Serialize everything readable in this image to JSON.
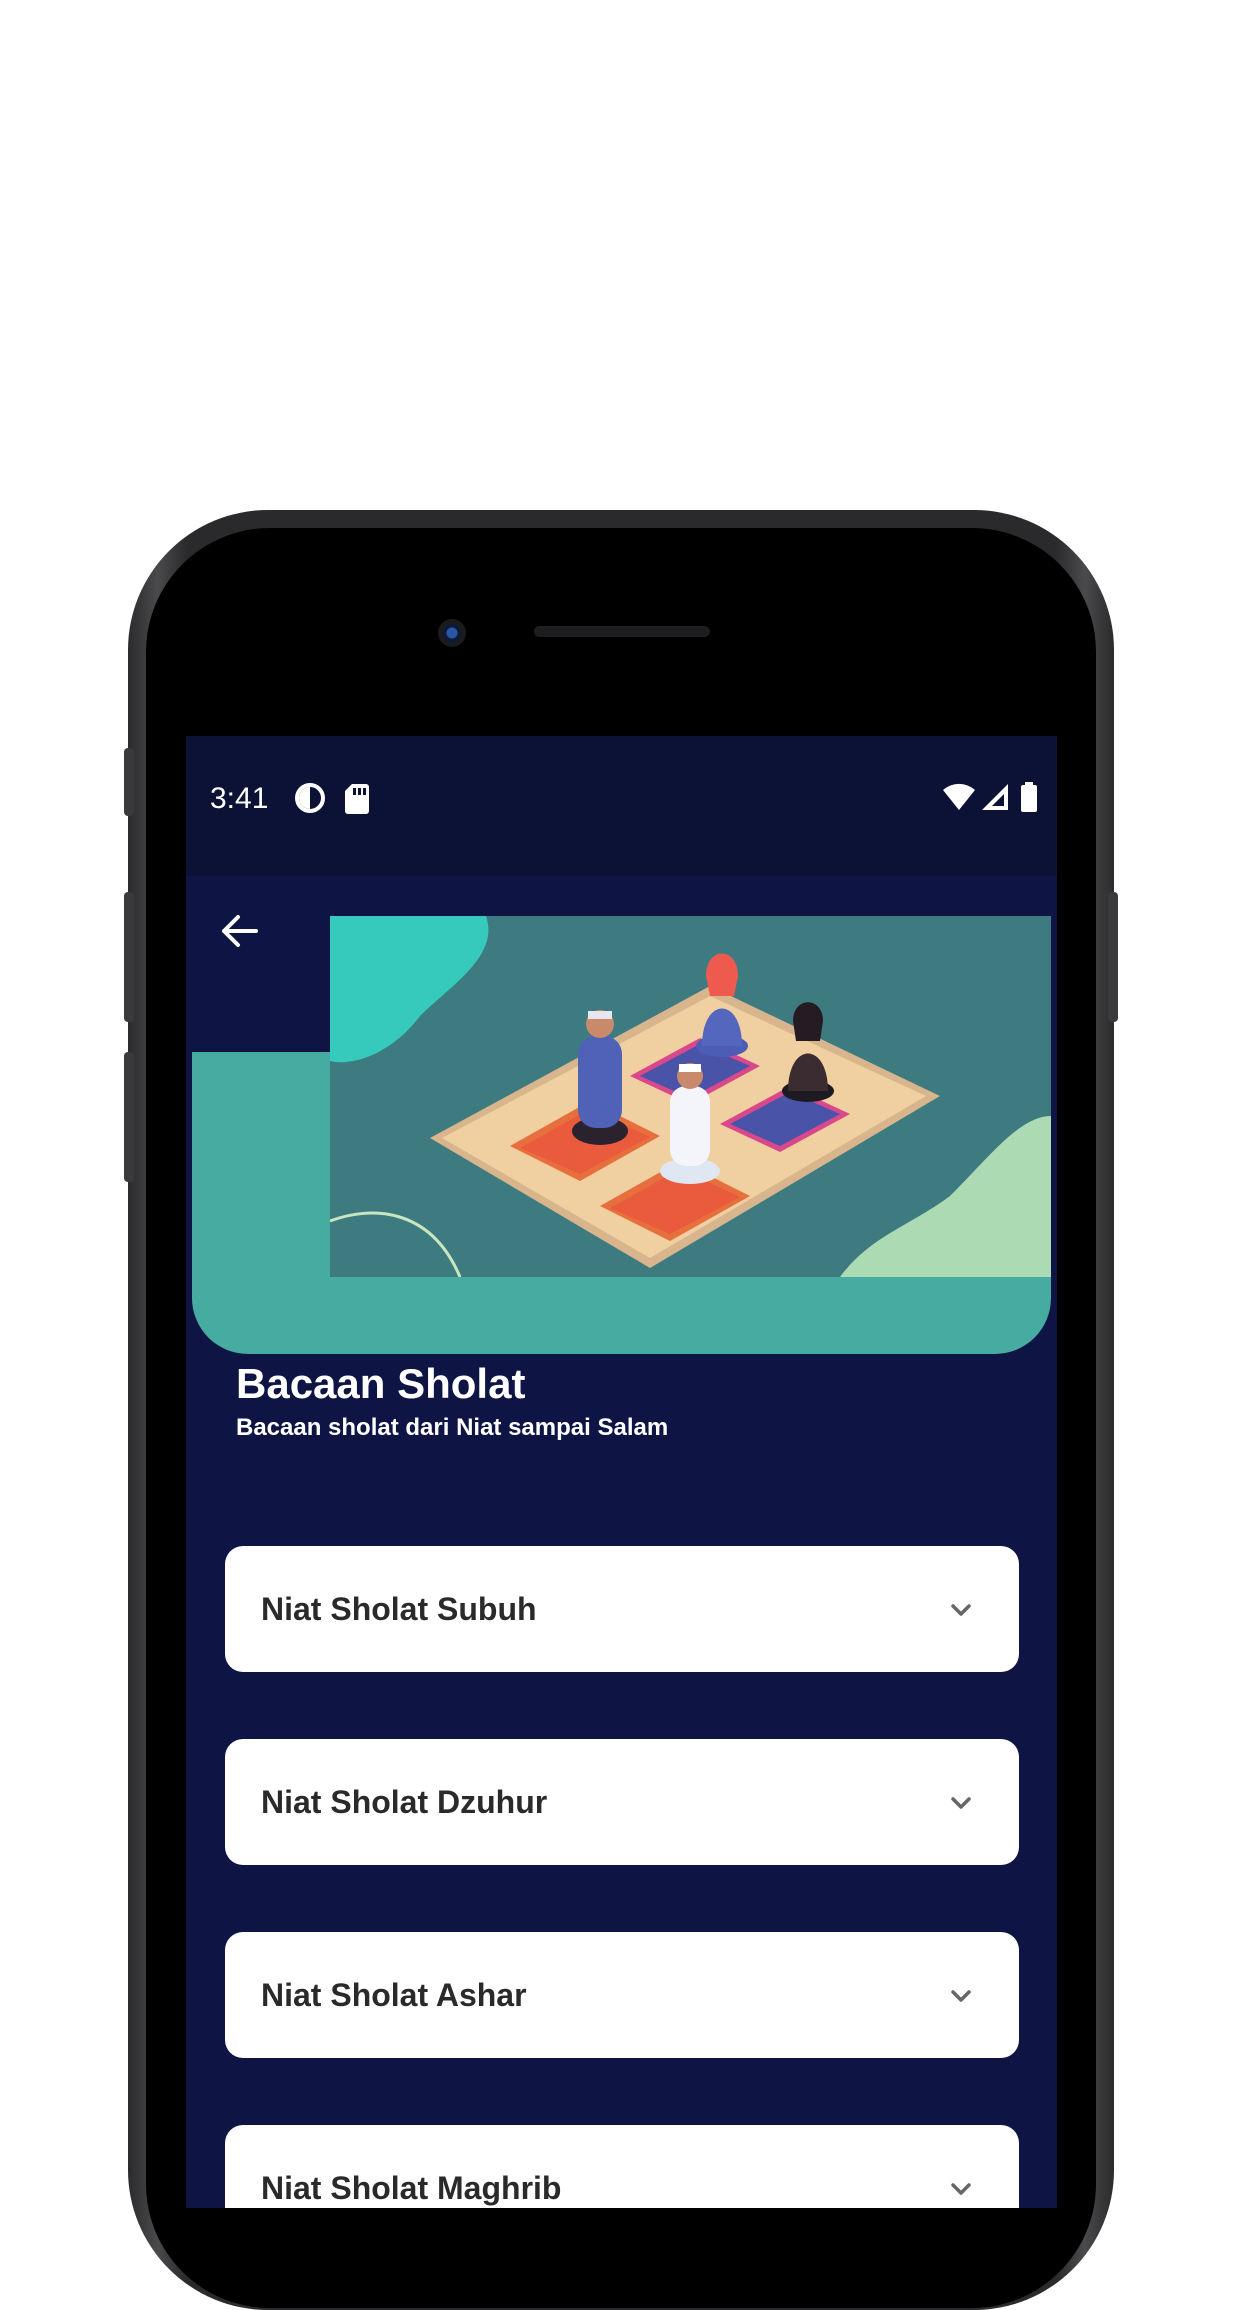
{
  "status_bar": {
    "time": "3:41",
    "icons": [
      "data-saver-icon",
      "sd-card-icon",
      "wifi-icon",
      "signal-icon",
      "battery-icon"
    ]
  },
  "header": {
    "back_icon": "arrow-left-icon",
    "title": "Bacaan Sholat",
    "subtitle": "Bacaan sholat dari Niat sampai Salam",
    "colors": {
      "card": "#46aba0",
      "hero_bg": "#3e7b80",
      "screen_bg": "#0e1444"
    }
  },
  "accordion_items": [
    {
      "label": "Niat Sholat Subuh",
      "icon": "chevron-down-icon"
    },
    {
      "label": "Niat Sholat Dzuhur",
      "icon": "chevron-down-icon"
    },
    {
      "label": "Niat Sholat Ashar",
      "icon": "chevron-down-icon"
    },
    {
      "label": "Niat Sholat Maghrib",
      "icon": "chevron-down-icon"
    }
  ]
}
